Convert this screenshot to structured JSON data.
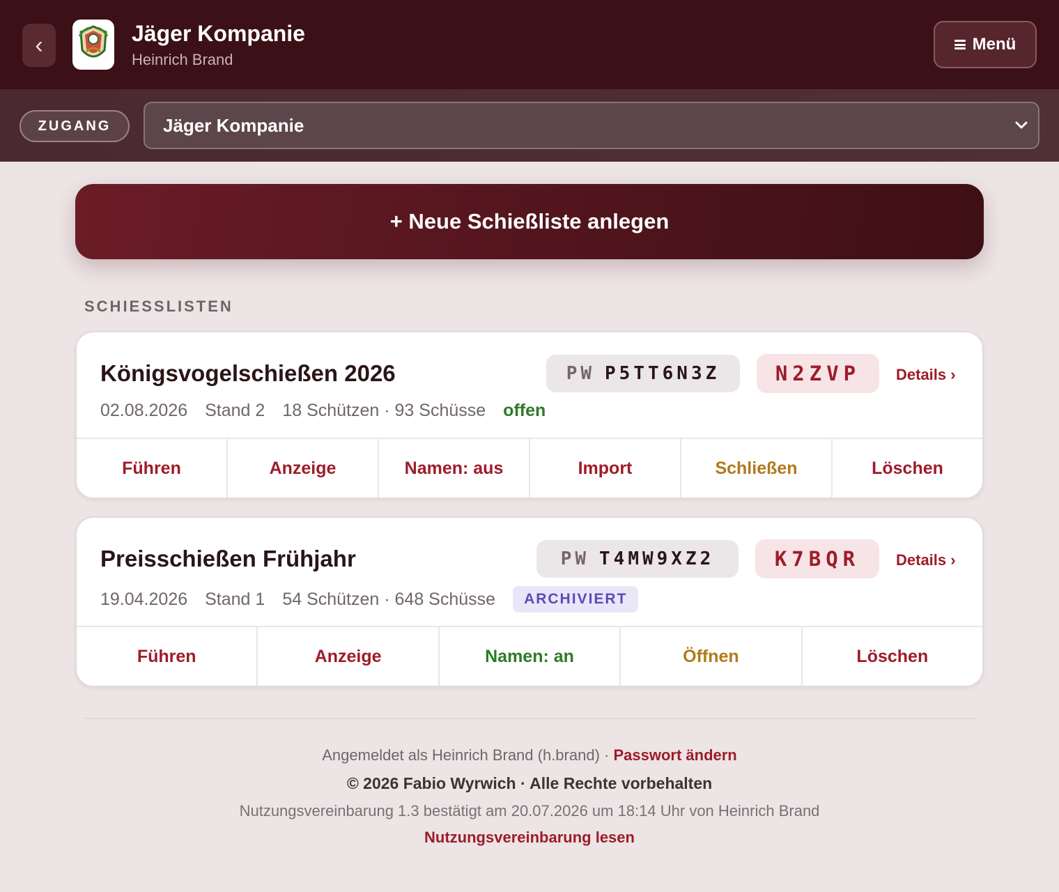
{
  "header": {
    "title": "Jäger Kompanie",
    "subtitle": "Heinrich Brand",
    "back_icon": "chevron-left-icon",
    "logo_icon": "club-crest-icon",
    "menu_label": "Menü"
  },
  "access": {
    "badge": "ZUGANG",
    "selected": "Jäger Kompanie"
  },
  "new_list_label": "+ Neue Schießliste anlegen",
  "section_label": "SCHIESSLISTEN",
  "lists": [
    {
      "title": "Königsvogelschießen 2026",
      "pw_label": "PW",
      "pw_value": "P5TT6N3Z",
      "code": "N2ZVP",
      "details": "Details ›",
      "date": "02.08.2026",
      "stand": "Stand 2",
      "stats": "18 Schützen · 93 Schüsse",
      "status": "offen",
      "actions": [
        "Führen",
        "Anzeige",
        "Namen: aus",
        "Import",
        "Schließen",
        "Löschen"
      ]
    },
    {
      "title": "Preisschießen Frühjahr",
      "pw_label": "PW",
      "pw_value": "T4MW9XZ2",
      "code": "K7BQR",
      "details": "Details ›",
      "date": "19.04.2026",
      "stand": "Stand 1",
      "stats": "54 Schützen · 648 Schüsse",
      "status": "ARCHIVIERT",
      "actions": [
        "Führen",
        "Anzeige",
        "Namen: an",
        "Öffnen",
        "Löschen"
      ]
    }
  ],
  "footer": {
    "logged_in_as": "Angemeldet als Heinrich Brand (h.brand) · ",
    "change_password": "Passwort ändern",
    "copyright": "© 2026 Fabio Wyrwich · Alle Rechte vorbehalten",
    "agreement_status": "Nutzungsvereinbarung 1.3 bestätigt am 20.07.2026 um 18:14 Uhr von Heinrich Brand",
    "agreement_link": "Nutzungsvereinbarung lesen"
  },
  "colors": {
    "brand_dark": "#3b1016",
    "accent_red": "#9e1c2a",
    "status_open": "#2f7a26",
    "status_archived": "#5a4bb8",
    "action_gold": "#b07a1e"
  }
}
